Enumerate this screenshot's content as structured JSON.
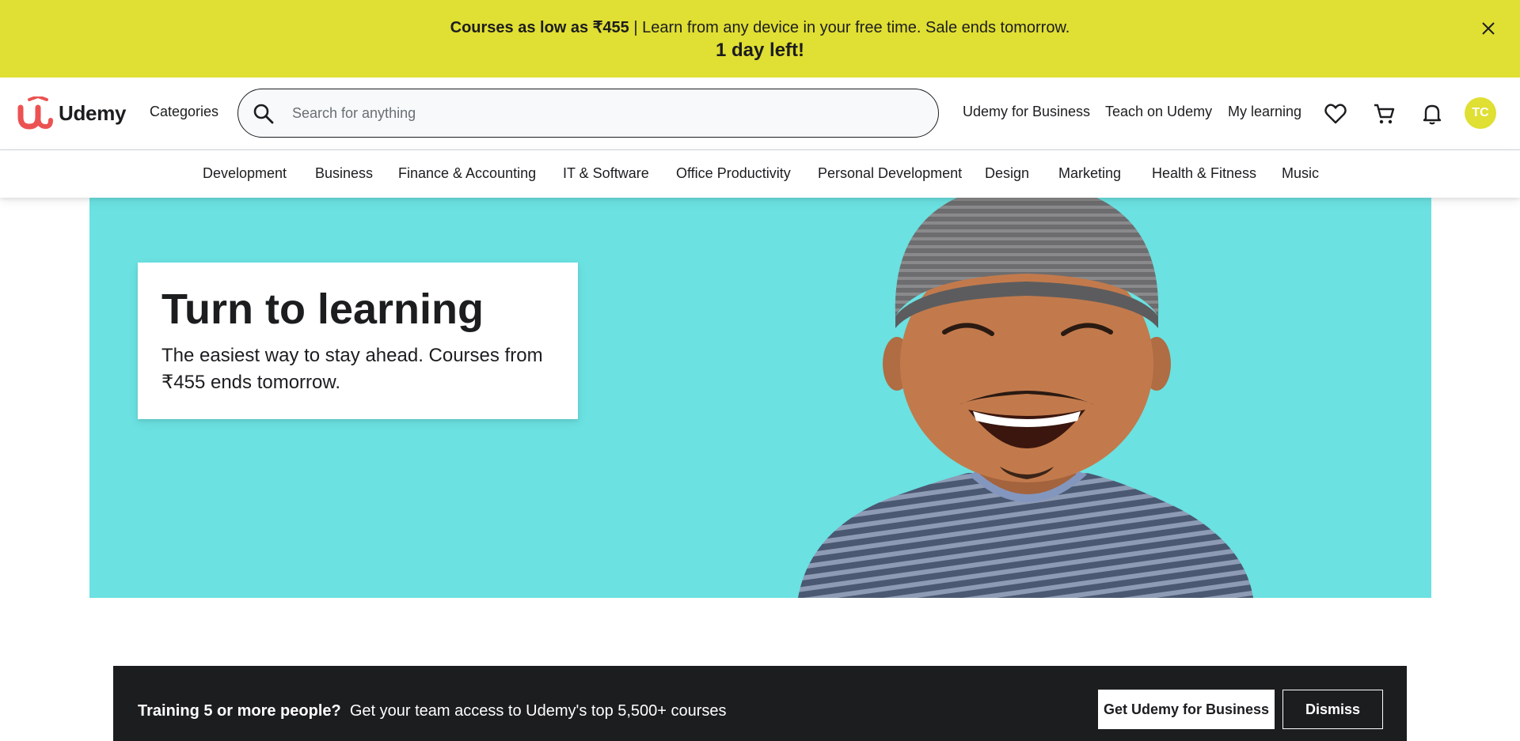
{
  "promo": {
    "bold_text": "Courses as low as ₹455",
    "rest_text": " | Learn from any device in your free time. Sale ends tomorrow.",
    "countdown": "1 day left!",
    "close_icon": "close-icon"
  },
  "header": {
    "logo_text": "Udemy",
    "categories_label": "Categories",
    "search_placeholder": "Search for anything",
    "links": {
      "business": "Udemy for Business",
      "teach": "Teach on Udemy",
      "my_learning": "My learning"
    },
    "icons": [
      "search-icon",
      "heart-icon",
      "cart-icon",
      "bell-icon"
    ],
    "avatar_initials": "TC"
  },
  "catnav": {
    "items": [
      "Development",
      "Business",
      "Finance & Accounting",
      "IT & Software",
      "Office Productivity",
      "Personal Development",
      "Design",
      "Marketing",
      "Health & Fitness",
      "Music"
    ]
  },
  "hero": {
    "title": "Turn to learning",
    "subtitle": "The easiest way to stay ahead. Courses from ₹455 ends tomorrow."
  },
  "business_strip": {
    "bold_text": "Training 5 or more people?",
    "text": "Get your team access to Udemy's top 5,500+ courses",
    "cta_label": "Get Udemy for Business",
    "dismiss_label": "Dismiss"
  },
  "colors": {
    "promo_bg": "#e0df33",
    "brand_red": "#ec5252",
    "hero_bg": "#6be1e1",
    "dark": "#1c1d1f"
  }
}
